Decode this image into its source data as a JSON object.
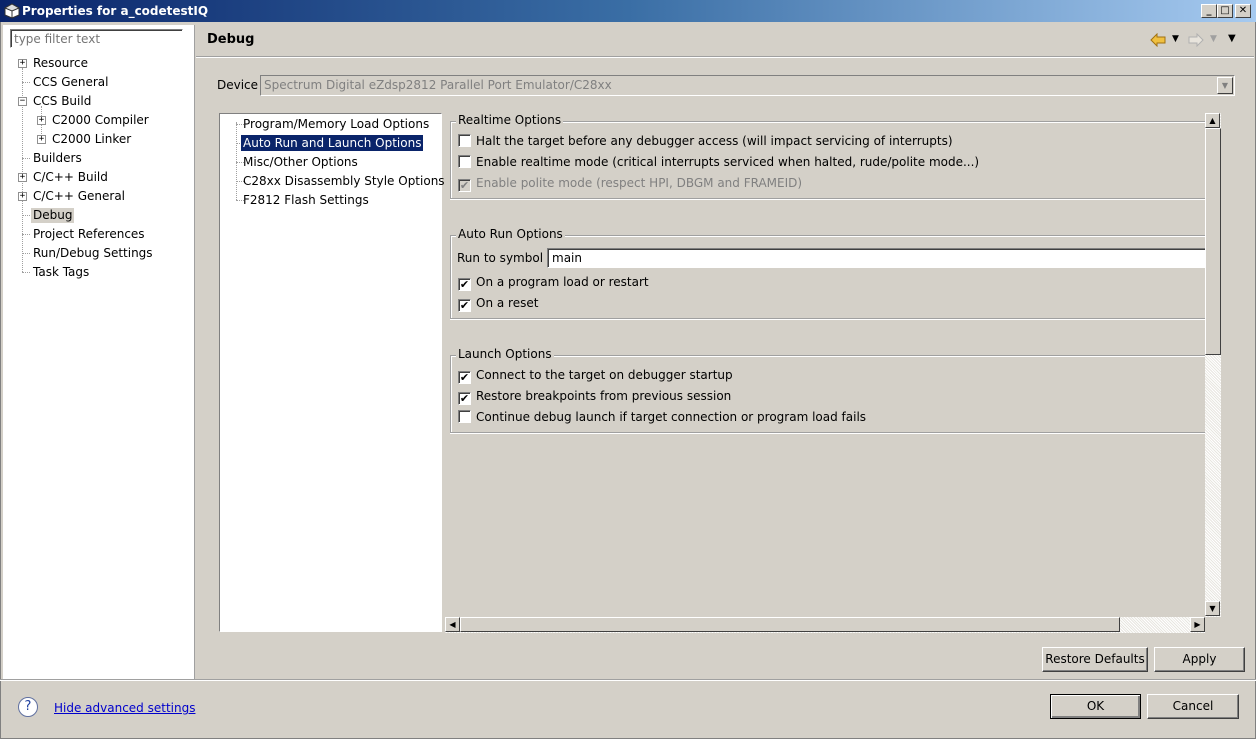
{
  "window": {
    "title": "Properties for a_codetestIQ",
    "controls": [
      "_",
      "□",
      "✕"
    ]
  },
  "sidebar": {
    "filter_placeholder": "type filter text",
    "items": [
      {
        "label": "Resource",
        "expander": "+"
      },
      {
        "label": "CCS General"
      },
      {
        "label": "CCS Build",
        "expander": "−"
      },
      {
        "label": "C2000 Compiler",
        "expander": "+"
      },
      {
        "label": "C2000 Linker",
        "expander": "+"
      },
      {
        "label": "Builders"
      },
      {
        "label": "C/C++ Build",
        "expander": "+"
      },
      {
        "label": "C/C++ General",
        "expander": "+"
      },
      {
        "label": "Debug",
        "selected": true
      },
      {
        "label": "Project References"
      },
      {
        "label": "Run/Debug Settings"
      },
      {
        "label": "Task Tags"
      }
    ]
  },
  "page": {
    "title": "Debug",
    "nav_icons": [
      "back-arrow-icon",
      "dropdown-icon",
      "forward-arrow-icon",
      "dropdown-icon",
      "menu-icon"
    ]
  },
  "device": {
    "label": "Device",
    "value": "Spectrum Digital eZdsp2812 Parallel Port Emulator/C28xx"
  },
  "options_list": [
    {
      "label": "Program/Memory Load Options"
    },
    {
      "label": "Auto Run and Launch Options",
      "selected": true
    },
    {
      "label": "Misc/Other Options"
    },
    {
      "label": "C28xx Disassembly Style Options"
    },
    {
      "label": "F2812 Flash Settings"
    }
  ],
  "realtime": {
    "legend": "Realtime Options",
    "items": [
      {
        "label": "Halt the target before any debugger access (will impact servicing of interrupts)",
        "checked": false,
        "enabled": true
      },
      {
        "label": "Enable realtime mode (critical interrupts serviced when halted, rude/polite mode...)",
        "checked": false,
        "enabled": true
      },
      {
        "label": "Enable polite mode (respect HPI, DBGM and FRAMEID)",
        "checked": true,
        "enabled": false
      }
    ]
  },
  "autorun": {
    "legend": "Auto Run Options",
    "symbol_label": "Run to symbol",
    "symbol_value": "main",
    "items": [
      {
        "label": "On a program load or restart",
        "checked": true
      },
      {
        "label": "On a reset",
        "checked": true
      }
    ]
  },
  "launch": {
    "legend": "Launch Options",
    "items": [
      {
        "label": "Connect to the target on debugger startup",
        "checked": true
      },
      {
        "label": "Restore breakpoints from previous session",
        "checked": true
      },
      {
        "label": "Continue debug launch if target connection or program load fails",
        "checked": false
      }
    ]
  },
  "buttons": {
    "restore_defaults": "Restore Defaults",
    "apply": "Apply",
    "ok": "OK",
    "cancel": "Cancel"
  },
  "footer": {
    "help_symbol": "?",
    "advanced_link": "Hide advanced settings"
  }
}
